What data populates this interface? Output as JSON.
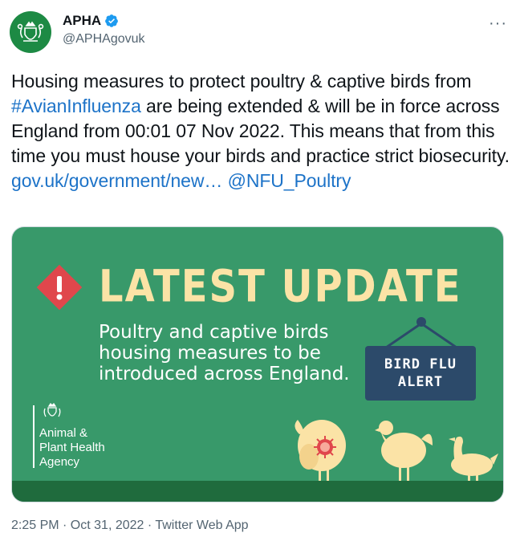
{
  "author": {
    "display_name": "APHA",
    "handle": "@APHAgovuk"
  },
  "menu": {
    "more_label": "···"
  },
  "tweet": {
    "text_part1": "Housing measures to protect poultry & captive birds from ",
    "hashtag": "#AvianInfluenza",
    "text_part2": " are being extended & will be in force across England from 00:01 07 Nov 2022. This means that from this time you must house your birds and practice strict biosecurity. ",
    "link": "gov.uk/government/new",
    "text_part3": "… ",
    "mention": "@NFU_Poultry"
  },
  "media": {
    "headline": "LATEST UPDATE",
    "subtext": "Poultry and captive birds housing measures to be introduced across England.",
    "sign_line1": "BIRD FLU",
    "sign_line2": "ALERT",
    "logo_line1": "Animal &",
    "logo_line2": "Plant Health",
    "logo_line3": "Agency",
    "colors": {
      "background": "#38996a",
      "headline": "#fbe3a6",
      "sign": "#2c4a6a",
      "alert": "#e0474c",
      "birds": "#fbe3a6"
    }
  },
  "timestamp": "2:25 PM · Oct 31, 2022 · Twitter Web App",
  "icons": {
    "avatar": "royal-crest-icon",
    "verified": "verified-badge-icon",
    "alert": "warning-diamond-icon"
  }
}
